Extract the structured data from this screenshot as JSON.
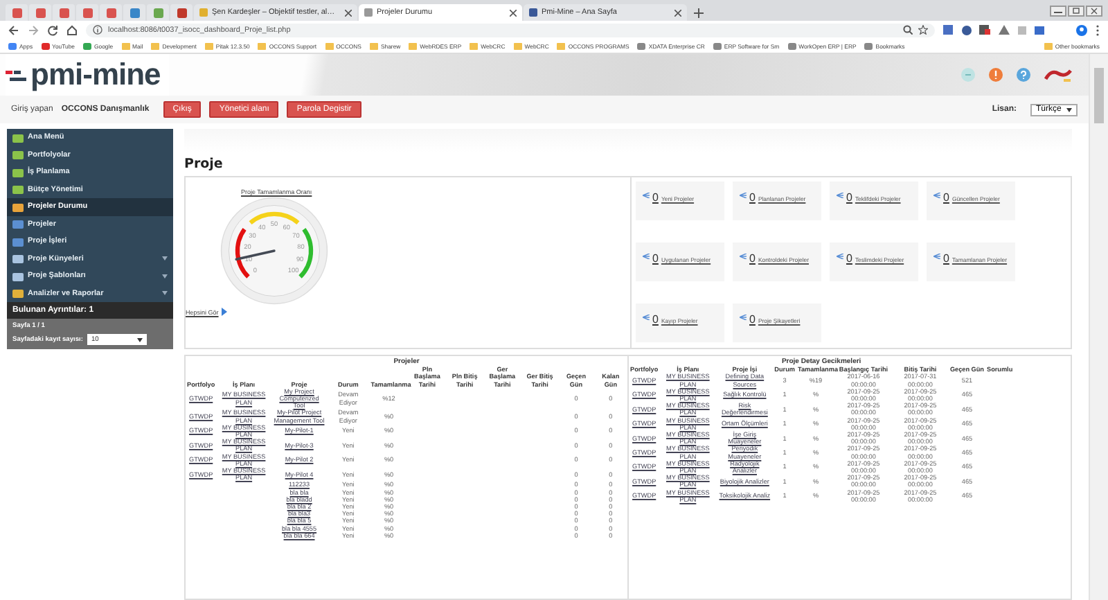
{
  "browser": {
    "pinned_tabs": [
      {
        "color": "#d9534f"
      },
      {
        "color": "#d9534f"
      },
      {
        "color": "#d9534f"
      },
      {
        "color": "#d9534f"
      },
      {
        "color": "#d9534f"
      },
      {
        "color": "#3a87c8"
      },
      {
        "color": "#6aa84f"
      },
      {
        "color": "#c0392b"
      }
    ],
    "tabs": [
      {
        "title": "Şen Kardeşler – Objektif testler, al…",
        "selected": false,
        "kind": "shop"
      },
      {
        "title": "Projeler Durumu",
        "selected": true,
        "kind": "page"
      },
      {
        "title": "Pmi-Mine – Ana Sayfa",
        "selected": false,
        "kind": "facebook"
      }
    ],
    "url": "localhost:8086/t0037_isocc_dashboard_Proje_list.php",
    "bookmarks": [
      {
        "label": "Apps",
        "kind": "apps"
      },
      {
        "label": "YouTube",
        "kind": "youtube"
      },
      {
        "label": "Google",
        "kind": "google"
      },
      {
        "label": "Mail",
        "kind": "folder"
      },
      {
        "label": "Development",
        "kind": "folder"
      },
      {
        "label": "Pitak 12.3.50",
        "kind": "folder"
      },
      {
        "label": "OCCONS Support",
        "kind": "folder"
      },
      {
        "label": "OCCONS",
        "kind": "folder"
      },
      {
        "label": "Sharew",
        "kind": "folder"
      },
      {
        "label": "WebRDES ERP",
        "kind": "folder"
      },
      {
        "label": "WebCRC",
        "kind": "folder"
      },
      {
        "label": "WebCRC",
        "kind": "folder"
      },
      {
        "label": "OCCONS PROGRAMS",
        "kind": "folder"
      },
      {
        "label": "XDATA Enterprise CR",
        "kind": "page"
      },
      {
        "label": "ERP Software for Sm",
        "kind": "page"
      },
      {
        "label": "WorkOpen ERP | ERP",
        "kind": "page"
      },
      {
        "label": "Bookmarks",
        "kind": "page"
      }
    ],
    "other_bookmarks": "Other bookmarks"
  },
  "header": {
    "logo": "pmi-mine"
  },
  "login_bar": {
    "label": "Giriş yapan",
    "user": "OCCONS Danışmanlık",
    "buttons": [
      "Çıkış",
      "Yönetici alanı",
      "Parola Degistir"
    ],
    "language_label": "Lisan:",
    "language": "Türkçe"
  },
  "sidebar": {
    "items": [
      {
        "label": "Ana Menü",
        "kind": "back",
        "selected": false,
        "submenu": false
      },
      {
        "label": "Portfolyolar",
        "kind": "back",
        "selected": false,
        "submenu": false
      },
      {
        "label": "İş Planlama",
        "kind": "back",
        "selected": false,
        "submenu": false
      },
      {
        "label": "Bütçe Yönetimi",
        "kind": "back",
        "selected": false,
        "submenu": false
      },
      {
        "label": "Projeler Durumu",
        "kind": "grid",
        "selected": true,
        "submenu": false
      },
      {
        "label": "Projeler",
        "kind": "bar",
        "selected": false,
        "submenu": false
      },
      {
        "label": "Proje İşleri",
        "kind": "bar",
        "selected": false,
        "submenu": false
      },
      {
        "label": "Proje Künyeleri",
        "kind": "doc",
        "selected": false,
        "submenu": true
      },
      {
        "label": "Proje Şablonları",
        "kind": "doc",
        "selected": false,
        "submenu": true
      },
      {
        "label": "Analizler ve Raporlar",
        "kind": "chart",
        "selected": false,
        "submenu": true
      }
    ],
    "found": "Bulunan Ayrıntılar: 1",
    "page": "Sayfa 1 / 1",
    "per_page_label": "Sayfadaki kayıt sayısı:",
    "per_page": "10"
  },
  "page_title": "Proje",
  "gauge": {
    "title": "Proje Tamamlanma Oranı",
    "ticks": [
      "0",
      "10",
      "20",
      "30",
      "40",
      "50",
      "60",
      "70",
      "80",
      "90",
      "100"
    ],
    "level": 0.12,
    "link": "Hepsini Gör"
  },
  "status_boxes": [
    {
      "count": "0",
      "label": "Yeni Projeler"
    },
    {
      "count": "0",
      "label": "Planlanan Projeler"
    },
    {
      "count": "0",
      "label": "Teklifdeki Projeler"
    },
    {
      "count": "0",
      "label": "Güncellen Projeler"
    },
    {
      "count": "0",
      "label": "Uygulanan Projeler"
    },
    {
      "count": "0",
      "label": "Kontroldeki Projeler"
    },
    {
      "count": "0",
      "label": "Teslimdeki Projeler"
    },
    {
      "count": "0",
      "label": "Tamamlanan Projeler"
    },
    {
      "count": "0",
      "label": "Kayıp Projeler"
    },
    {
      "count": "0",
      "label": "Proje Şikayetleri"
    }
  ],
  "projects_table": {
    "title": "Projeler",
    "columns": [
      {
        "label": "Portfolyo",
        "kind": "link"
      },
      {
        "label": "İş Planı",
        "kind": "link"
      },
      {
        "label": "Proje",
        "kind": "link"
      },
      {
        "label": "Durum",
        "kind": "text"
      },
      {
        "label": "Tamamlanma",
        "kind": "text"
      },
      {
        "label": "Pln Başlama Tarihi"
      },
      {
        "label": "Pln Bitiş Tarihi"
      },
      {
        "label": "Ger Başlama Tarihi"
      },
      {
        "label": "Ger Bitiş Tarihi"
      },
      {
        "label": "Geçen Gün",
        "kind": "text"
      },
      {
        "label": "Kalan Gün",
        "kind": "text"
      }
    ],
    "rows": [
      [
        "GTWDP",
        "MY BUSINESS PLAN",
        "My Project Computerized Tool",
        "Devam Ediyor",
        "%12",
        null,
        null,
        null,
        null,
        "0",
        "0"
      ],
      [
        "GTWDP",
        "MY BUSINESS PLAN",
        "My-Pilot Project Management Tool",
        "Devam Ediyor",
        "%0",
        null,
        null,
        null,
        null,
        "0",
        "0"
      ],
      [
        "GTWDP",
        "MY BUSINESS PLAN",
        "My-Pilot-1",
        "Yeni",
        "%0",
        null,
        null,
        null,
        null,
        "0",
        "0"
      ],
      [
        "GTWDP",
        "MY BUSINESS PLAN",
        "My-Pilot-3",
        "Yeni",
        "%0",
        null,
        null,
        null,
        null,
        "0",
        "0"
      ],
      [
        "GTWDP",
        "MY BUSINESS PLAN",
        "My-Pilot 2",
        "Yeni",
        "%0",
        null,
        null,
        null,
        null,
        "0",
        "0"
      ],
      [
        "GTWDP",
        "MY BUSINESS PLAN",
        "My-Pilot 4",
        "Yeni",
        "%0",
        null,
        null,
        null,
        null,
        "0",
        "0"
      ],
      [
        null,
        null,
        "112233",
        "Yeni",
        "%0",
        null,
        null,
        null,
        null,
        "0",
        "0"
      ],
      [
        null,
        null,
        "bla bla",
        "Yeni",
        "%0",
        null,
        null,
        null,
        null,
        "0",
        "0"
      ],
      [
        null,
        null,
        "bla bladd",
        "Yeni",
        "%0",
        null,
        null,
        null,
        null,
        "0",
        "0"
      ],
      [
        null,
        null,
        "bla bla 2",
        "Yeni",
        "%0",
        null,
        null,
        null,
        null,
        "0",
        "0"
      ],
      [
        null,
        null,
        "bla bla3",
        "Yeni",
        "%0",
        null,
        null,
        null,
        null,
        "0",
        "0"
      ],
      [
        null,
        null,
        "bla bla 5",
        "Yeni",
        "%0",
        null,
        null,
        null,
        null,
        "0",
        "0"
      ],
      [
        null,
        null,
        "bla bla 4555",
        "Yeni",
        "%0",
        null,
        null,
        null,
        null,
        "0",
        "0"
      ],
      [
        null,
        null,
        "bla bla 664",
        "Yeni",
        "%0",
        null,
        null,
        null,
        null,
        "0",
        "0"
      ]
    ]
  },
  "delays_table": {
    "title": "Proje Detay Gecikmeleri",
    "columns": [
      {
        "label": "Portfolyo",
        "kind": "link"
      },
      {
        "label": "İş Planı",
        "kind": "link"
      },
      {
        "label": "Proje İşi",
        "kind": "link"
      },
      {
        "label": "Durum",
        "kind": "text"
      },
      {
        "label": "Tamamlanma",
        "kind": "text"
      },
      {
        "label": "Başlangıç Tarihi",
        "kind": "text"
      },
      {
        "label": "Bitiş Tarihi",
        "kind": "text"
      },
      {
        "label": "Geçen Gün",
        "kind": "text"
      },
      {
        "label": "Sorumlu"
      }
    ],
    "rows": [
      [
        "GTWDP",
        "MY BUSINESS PLAN",
        "Defining Data Sources",
        "3",
        "%19",
        "2017-06-16 00:00:00",
        "2017-07-31 00:00:00",
        "521",
        null
      ],
      [
        "GTWDP",
        "MY BUSINESS PLAN",
        "Sağlık Kontrolü",
        "1",
        "%",
        "2017-09-25 00:00:00",
        "2017-09-25 00:00:00",
        "465",
        null
      ],
      [
        "GTWDP",
        "MY BUSINESS PLAN",
        "Risk Değerlendirmesi",
        "1",
        "%",
        "2017-09-25 00:00:00",
        "2017-09-25 00:00:00",
        "465",
        null
      ],
      [
        "GTWDP",
        "MY BUSINESS PLAN",
        "Ortam Ölçümleri",
        "1",
        "%",
        "2017-09-25 00:00:00",
        "2017-09-25 00:00:00",
        "465",
        null
      ],
      [
        "GTWDP",
        "MY BUSINESS PLAN",
        "İşe Giriş Muayeneler",
        "1",
        "%",
        "2017-09-25 00:00:00",
        "2017-09-25 00:00:00",
        "465",
        null
      ],
      [
        "GTWDP",
        "MY BUSINESS PLAN",
        "Periyodik Muayeneler",
        "1",
        "%",
        "2017-09-25 00:00:00",
        "2017-09-25 00:00:00",
        "465",
        null
      ],
      [
        "GTWDP",
        "MY BUSINESS PLAN",
        "Radyolojik Analizler",
        "1",
        "%",
        "2017-09-25 00:00:00",
        "2017-09-25 00:00:00",
        "465",
        null
      ],
      [
        "GTWDP",
        "MY BUSINESS PLAN",
        "Biyolojik Analizler",
        "1",
        "%",
        "2017-09-25 00:00:00",
        "2017-09-25 00:00:00",
        "465",
        null
      ],
      [
        "GTWDP",
        "MY BUSINESS PLAN",
        "Toksikolojik Analiz",
        "1",
        "%",
        "2017-09-25 00:00:00",
        "2017-09-25 00:00:00",
        "465",
        null
      ]
    ]
  }
}
